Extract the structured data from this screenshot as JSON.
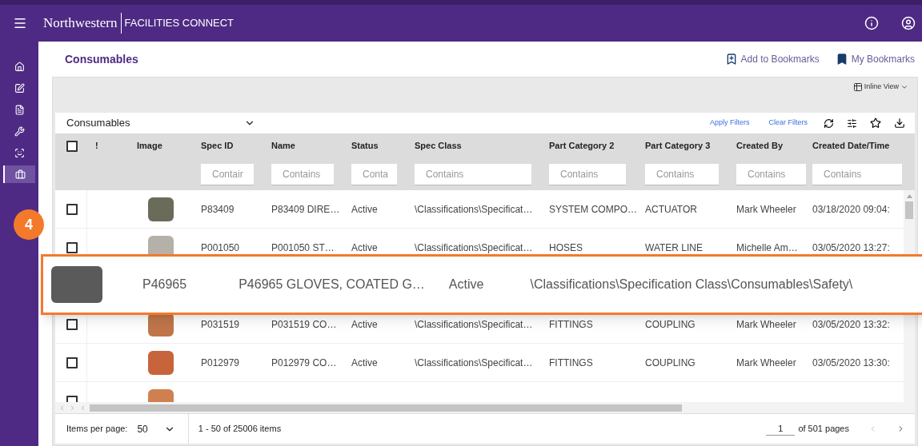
{
  "header": {
    "brand": "Northwestern",
    "product": "FACILITIES CONNECT"
  },
  "sidebar": {
    "items": [
      {
        "selected": false
      },
      {
        "selected": false
      },
      {
        "selected": false
      },
      {
        "selected": false
      },
      {
        "selected": false
      },
      {
        "selected": true
      }
    ]
  },
  "step_badge": "4",
  "page": {
    "title": "Consumables",
    "add_bookmark": "Add to Bookmarks",
    "my_bookmarks": "My Bookmarks",
    "view": "Inline View"
  },
  "toolbar": {
    "list": "Consumables",
    "apply": "Apply Filters",
    "clear": "Clear Filters"
  },
  "table": {
    "select_all_checked": false,
    "columns": [
      {
        "label": "!"
      },
      {
        "label": "Image"
      },
      {
        "label": "Spec ID",
        "placeholder": "Contair"
      },
      {
        "label": "Name",
        "placeholder": "Contains"
      },
      {
        "label": "Status",
        "placeholder": "Conta"
      },
      {
        "label": "Spec Class",
        "placeholder": "Contains"
      },
      {
        "label": "Part Category 2",
        "placeholder": "Contains"
      },
      {
        "label": "Part Category 3",
        "placeholder": "Contains"
      },
      {
        "label": "Created By",
        "placeholder": "Contains"
      },
      {
        "label": "Created Date/Time",
        "placeholder": "Contains"
      }
    ],
    "rows": [
      {
        "checked": false,
        "cells": [
          "",
          "",
          "P83409",
          "P83409 DIRE…",
          "Active",
          "\\Classifications\\Specificat…",
          "SYSTEM COMPO…",
          "ACTUATOR",
          "Mark Wheeler",
          "03/18/2020 09:04:"
        ]
      },
      {
        "checked": false,
        "cells": [
          "",
          "",
          "P001050",
          "P001050 ST…",
          "Active",
          "\\Classifications\\Specificat…",
          "HOSES",
          "WATER LINE",
          "Michelle Am…",
          "03/05/2020 13:27:"
        ]
      },
      {
        "checked": false,
        "cells": [
          "",
          "",
          "P031519",
          "P031519 CO…",
          "Active",
          "\\Classifications\\Specificat…",
          "FITTINGS",
          "COUPLING",
          "Mark Wheeler",
          "03/05/2020 13:32:"
        ]
      },
      {
        "checked": false,
        "cells": [
          "",
          "",
          "P012979",
          "P012979 CO…",
          "Active",
          "\\Classifications\\Specificat…",
          "FITTINGS",
          "COUPLING",
          "Mark Wheeler",
          "03/05/2020 13:30:"
        ]
      },
      {
        "checked": false,
        "cells": []
      }
    ]
  },
  "callout": {
    "cells": [
      "P46965",
      "P46965 GLOVES, COATED G…",
      "Active",
      "\\Classifications\\Specification Class\\Consumables\\Safety\\"
    ]
  },
  "footer": {
    "per_page_label": "Items per page:",
    "per_page": "50",
    "range": "1 - 50 of 25006 items",
    "page": "1",
    "pages": "of 501 pages"
  }
}
